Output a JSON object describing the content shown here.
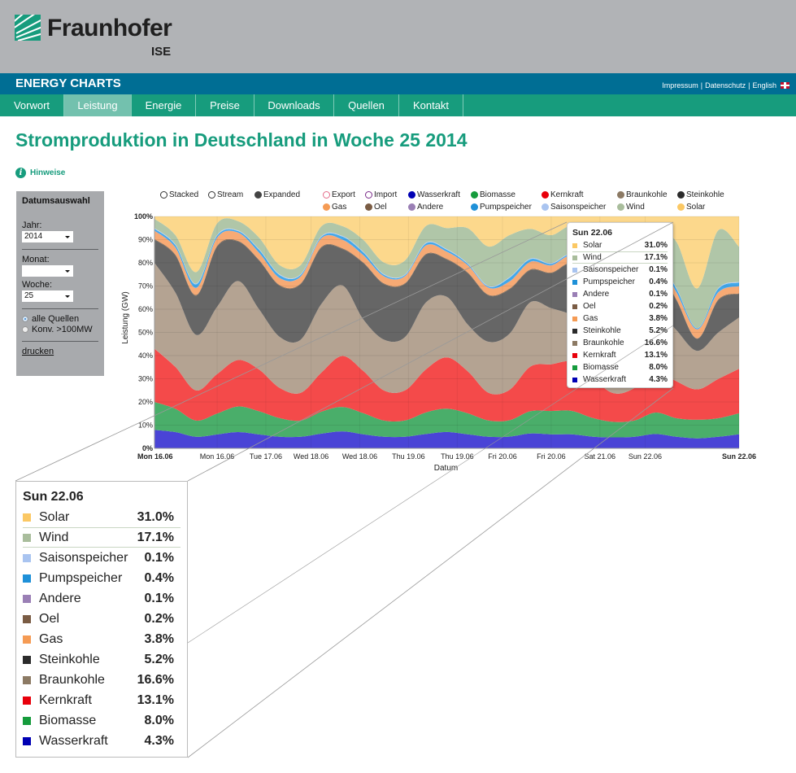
{
  "header": {
    "logo_text": "Fraunhofer",
    "logo_sub": "ISE",
    "brand": "ENERGY CHARTS",
    "top_links": [
      "Impressum",
      "Datenschutz",
      "English"
    ]
  },
  "nav": {
    "tabs": [
      {
        "label": "Vorwort",
        "active": false
      },
      {
        "label": "Leistung",
        "active": true
      },
      {
        "label": "Energie",
        "active": false
      },
      {
        "label": "Preise",
        "active": false
      },
      {
        "label": "Downloads",
        "active": false
      },
      {
        "label": "Quellen",
        "active": false
      },
      {
        "label": "Kontakt",
        "active": false
      }
    ]
  },
  "page": {
    "title": "Stromproduktion in Deutschland in Woche 25 2014",
    "hint_label": "Hinweise"
  },
  "sidebar": {
    "title": "Datumsauswahl",
    "year_label": "Jahr:",
    "year_value": "2014",
    "month_label": "Monat:",
    "month_value": "",
    "week_label": "Woche:",
    "week_value": "25",
    "radio_all": "alle Quellen",
    "radio_conv": "Konv. >100MW",
    "radio_selected": "alle Quellen",
    "print_label": "drucken"
  },
  "modes": [
    {
      "label": "Stacked",
      "selected": false
    },
    {
      "label": "Stream",
      "selected": false
    },
    {
      "label": "Expanded",
      "selected": true
    }
  ],
  "colors": {
    "Export": "#e46c8a",
    "Import": "#7a2a8a",
    "Wasserkraft": "#0000b4",
    "Biomasse": "#159b3c",
    "Kernkraft": "#e8000b",
    "Braunkohle": "#8c7a64",
    "Steinkohle": "#2b2b2b",
    "Gas": "#f59b54",
    "Oel": "#7a5c44",
    "Andere": "#9a7fb5",
    "Pumpspeicher": "#1e90d8",
    "Saisonspeicher": "#a9c4f0",
    "Wind": "#a9bd9c",
    "Solar": "#fbc864"
  },
  "area_fill": {
    "Wasserkraft": "#4a44d6",
    "Biomasse": "#4aae6a",
    "Kernkraft": "#f44a4a",
    "Braunkohle": "#b4a392",
    "Steinkohle": "#666666",
    "Oel": "#8a6c54",
    "Gas": "#f7aa74",
    "Andere": "#a890c4",
    "Pumpspeicher": "#42a8ea",
    "Saisonspeicher": "#b8d0f4",
    "Wind": "#b0c6a8",
    "Solar": "#fcd88c"
  },
  "tooltip": {
    "title": "Sun 22.06",
    "highlight": "Wind",
    "rows": [
      {
        "name": "Solar",
        "value": "31.0%"
      },
      {
        "name": "Wind",
        "value": "17.1%"
      },
      {
        "name": "Saisonspeicher",
        "value": "0.1%"
      },
      {
        "name": "Pumpspeicher",
        "value": "0.4%"
      },
      {
        "name": "Andere",
        "value": "0.1%"
      },
      {
        "name": "Oel",
        "value": "0.2%"
      },
      {
        "name": "Gas",
        "value": "3.8%"
      },
      {
        "name": "Steinkohle",
        "value": "5.2%"
      },
      {
        "name": "Braunkohle",
        "value": "16.6%"
      },
      {
        "name": "Kernkraft",
        "value": "13.1%"
      },
      {
        "name": "Biomasse",
        "value": "8.0%"
      },
      {
        "name": "Wasserkraft",
        "value": "4.3%"
      }
    ]
  },
  "chart_data": {
    "type": "area",
    "mode": "expanded (100% stacked)",
    "title": "",
    "xlabel": "Datum",
    "ylabel": "Leistung (GW)",
    "ylim": [
      0,
      100
    ],
    "yticks": [
      "0%",
      "10%",
      "20%",
      "30%",
      "40%",
      "50%",
      "60%",
      "70%",
      "80%",
      "90%",
      "100%"
    ],
    "xlim_hours": [
      0,
      168
    ],
    "xticks": [
      {
        "h": 0,
        "label": "Mon 16.06",
        "bold": true
      },
      {
        "h": 18,
        "label": "Mon 16.06",
        "bold": false
      },
      {
        "h": 32,
        "label": "Tue 17.06",
        "bold": false
      },
      {
        "h": 45,
        "label": "Wed 18.06",
        "bold": false
      },
      {
        "h": 59,
        "label": "Wed 18.06",
        "bold": false
      },
      {
        "h": 73,
        "label": "Thu 19.06",
        "bold": false
      },
      {
        "h": 87,
        "label": "Thu 19.06",
        "bold": false
      },
      {
        "h": 100,
        "label": "Fri 20.06",
        "bold": false
      },
      {
        "h": 114,
        "label": "Fri 20.06",
        "bold": false
      },
      {
        "h": 128,
        "label": "Sat 21.06",
        "bold": false
      },
      {
        "h": 141,
        "label": "Sun 22.06",
        "bold": false
      },
      {
        "h": 168,
        "label": "Sun 22.06",
        "bold": true
      }
    ],
    "grid": true,
    "legend": "top",
    "legend_entries": [
      "Export",
      "Import",
      "Wasserkraft",
      "Biomasse",
      "Kernkraft",
      "Braunkohle",
      "Steinkohle",
      "Gas",
      "Oel",
      "Andere",
      "Pumpspeicher",
      "Saisonspeicher",
      "Wind",
      "Solar"
    ],
    "hover_hour": 158,
    "x_hours": [
      0,
      6,
      12,
      18,
      24,
      30,
      36,
      42,
      48,
      54,
      60,
      66,
      72,
      78,
      84,
      90,
      96,
      102,
      108,
      114,
      120,
      126,
      132,
      138,
      144,
      150,
      156,
      162,
      168
    ],
    "series": [
      {
        "name": "Wasserkraft",
        "values": [
          8,
          7,
          5,
          6,
          7,
          6,
          5,
          5,
          6,
          7,
          6,
          5,
          5,
          6,
          7,
          6,
          5,
          5,
          6,
          6,
          6,
          5,
          5,
          5,
          6,
          5,
          4.3,
          5,
          6
        ]
      },
      {
        "name": "Biomasse",
        "values": [
          12,
          10,
          7,
          9,
          11,
          10,
          8,
          7,
          9,
          10,
          9,
          7,
          7,
          9,
          10,
          9,
          7,
          7,
          9,
          10,
          10,
          8,
          7,
          7,
          9,
          8,
          8.0,
          8,
          9
        ]
      },
      {
        "name": "Kernkraft",
        "values": [
          23,
          18,
          13,
          17,
          20,
          18,
          13,
          12,
          16,
          21,
          18,
          13,
          13,
          18,
          22,
          18,
          12,
          13,
          18,
          20,
          21,
          17,
          13,
          14,
          18,
          16,
          13.1,
          17,
          19
        ]
      },
      {
        "name": "Braunkohle",
        "values": [
          37,
          32,
          24,
          29,
          34,
          26,
          22,
          23,
          28,
          29,
          22,
          22,
          23,
          28,
          26,
          20,
          22,
          24,
          26,
          24,
          20,
          21,
          24,
          27,
          26,
          22,
          16.6,
          20,
          22
        ]
      },
      {
        "name": "Steinkohle",
        "values": [
          10,
          16,
          17,
          26,
          17,
          21,
          22,
          24,
          23,
          15,
          24,
          24,
          23,
          20,
          16,
          22,
          20,
          19,
          13,
          15,
          22,
          19,
          11,
          21,
          18,
          13,
          5.2,
          14,
          10
        ]
      },
      {
        "name": "Oel",
        "values": [
          0.3,
          0.3,
          0.3,
          0.3,
          0.3,
          0.3,
          0.3,
          0.3,
          0.3,
          0.3,
          0.3,
          0.3,
          0.3,
          0.3,
          0.3,
          0.3,
          0.3,
          0.3,
          0.3,
          0.3,
          0.3,
          0.3,
          0.3,
          0.3,
          0.3,
          0.3,
          0.2,
          0.3,
          0.3
        ]
      },
      {
        "name": "Gas",
        "values": [
          3.5,
          3,
          3,
          3.5,
          3.5,
          3,
          3,
          3,
          3.5,
          3.5,
          3,
          3,
          3,
          3.5,
          3,
          3,
          3,
          3,
          3,
          3,
          3,
          3,
          3,
          3.5,
          3,
          3,
          3.8,
          3,
          3
        ]
      },
      {
        "name": "Andere",
        "values": [
          0.1,
          0.1,
          0.1,
          0.1,
          0.1,
          0.1,
          0.1,
          0.1,
          0.1,
          0.1,
          0.1,
          0.1,
          0.1,
          0.1,
          0.1,
          0.1,
          0.1,
          0.1,
          0.1,
          0.1,
          0.1,
          0.1,
          0.1,
          0.1,
          0.1,
          0.1,
          0.1,
          0.1,
          0.1
        ]
      },
      {
        "name": "Pumpspeicher",
        "values": [
          0.8,
          1,
          1.5,
          0.8,
          0.6,
          1.2,
          1.2,
          0.6,
          0.5,
          1.2,
          1.2,
          0.6,
          0.4,
          0.8,
          0.8,
          0.5,
          0.4,
          1.5,
          1,
          0.6,
          0.6,
          2,
          1.5,
          0.6,
          0.5,
          1.5,
          0.4,
          1.5,
          1.5
        ]
      },
      {
        "name": "Saisonspeicher",
        "values": [
          0.3,
          0.3,
          0.3,
          0.3,
          0.3,
          0.3,
          0.3,
          0.3,
          0.3,
          0.3,
          0.3,
          0.3,
          0.3,
          0.3,
          0.3,
          0.3,
          0.3,
          0.3,
          0.3,
          0.3,
          0.3,
          0.3,
          0.3,
          0.3,
          0.3,
          0.3,
          0.1,
          0.3,
          0.3
        ]
      },
      {
        "name": "Wind",
        "values": [
          4,
          4,
          5,
          5,
          4,
          5,
          4,
          4,
          4,
          4,
          5,
          5,
          6,
          7,
          9,
          15,
          17,
          18,
          12,
          12,
          12,
          14,
          17,
          15,
          12,
          20,
          17.1,
          25,
          15
        ]
      },
      {
        "name": "Solar",
        "values": [
          1,
          8,
          24,
          3,
          2,
          9,
          21,
          21,
          4,
          4,
          10,
          20,
          19,
          4,
          5,
          5,
          13,
          8,
          5,
          8,
          4,
          10,
          23,
          6,
          4,
          11,
          31.0,
          6,
          13
        ]
      }
    ]
  }
}
